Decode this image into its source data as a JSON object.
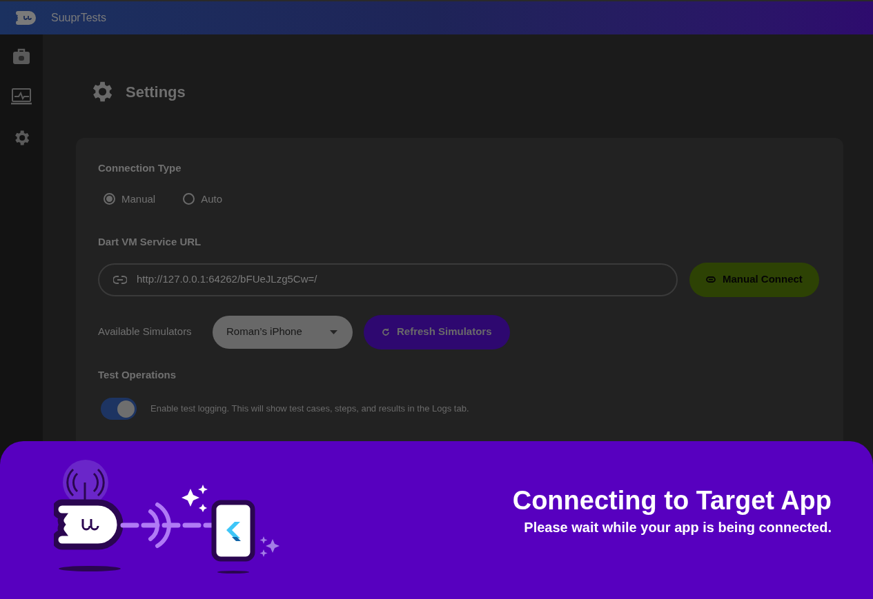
{
  "app": {
    "title": "SuuprTests"
  },
  "page": {
    "title": "Settings"
  },
  "connection_type": {
    "label": "Connection Type",
    "options": [
      {
        "label": "Manual",
        "selected": true
      },
      {
        "label": "Auto",
        "selected": false
      }
    ]
  },
  "service_url": {
    "label": "Dart VM Service URL",
    "value": "http://127.0.0.1:64262/bFUeJLzg5Cw=/",
    "button": "Manual Connect"
  },
  "simulators": {
    "label": "Available Simulators",
    "value": "Roman’s iPhone",
    "button": "Refresh Simulators"
  },
  "test_operations": {
    "label": "Test Operations",
    "toggle": {
      "on": true,
      "label": "Enable test logging. This will show test cases, steps, and results in the Logs tab."
    }
  },
  "overlay": {
    "title": "Connecting to Target App",
    "message": "Please wait while your app is being connected."
  }
}
